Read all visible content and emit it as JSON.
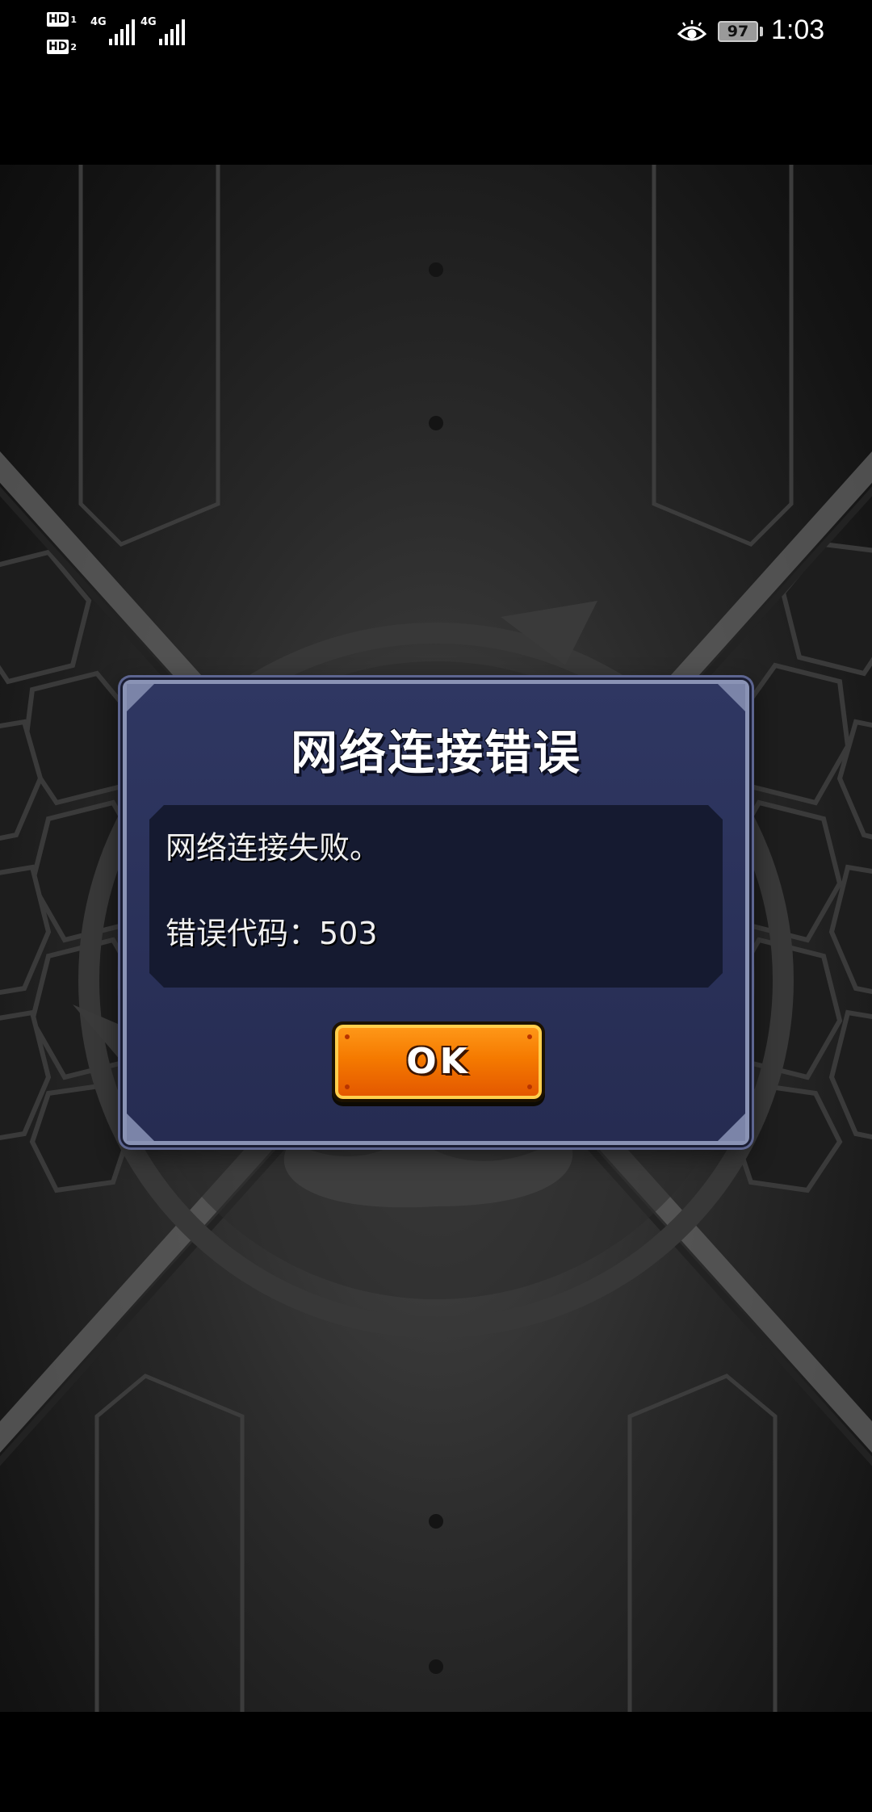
{
  "status_bar": {
    "sim1": {
      "hd": "HD",
      "index": "1",
      "network": "4G"
    },
    "sim2": {
      "hd": "HD",
      "index": "2",
      "network": "4G"
    },
    "eye_comfort_icon": "eye-icon",
    "battery_level": "97",
    "time": "1:03"
  },
  "dialog": {
    "title": "网络连接错误",
    "message_line_1": "网络连接失败。",
    "message_line_2": "错误代码：503",
    "ok_label": "OK"
  },
  "colors": {
    "dialog_bg": "#2b3260",
    "dialog_border": "#8a93b5",
    "message_panel_bg": "#151a30",
    "ok_button_orange": "#f57a00",
    "ok_button_rim": "#ffcf4d"
  }
}
